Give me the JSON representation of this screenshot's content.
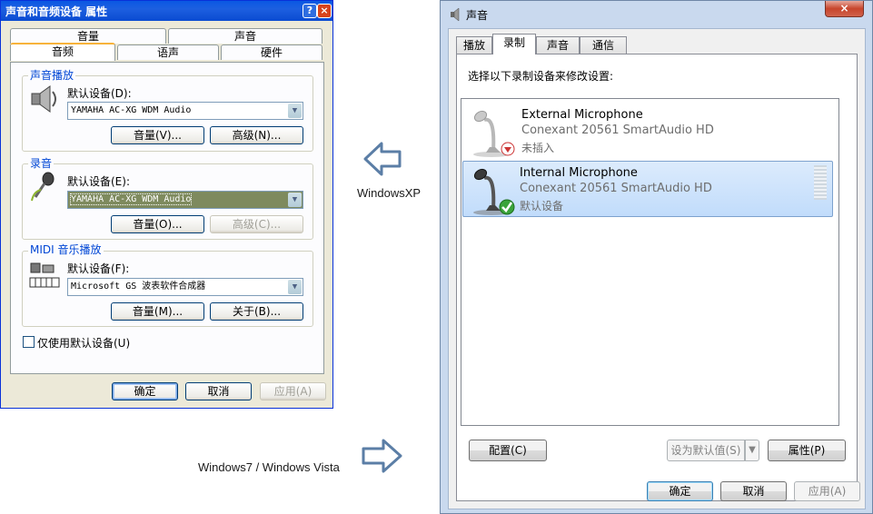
{
  "xp_dialog": {
    "title": "声音和音频设备 属性",
    "help_btn": "?",
    "close_btn": "×",
    "tabs_top": [
      "音量",
      "声音"
    ],
    "tabs_bottom": [
      "音频",
      "语声",
      "硬件"
    ],
    "sound_playback": {
      "group": "声音播放",
      "default_device_label": "默认设备(D):",
      "device": "YAMAHA AC-XG WDM Audio",
      "volume_btn": "音量(V)...",
      "advanced_btn": "高级(N)..."
    },
    "recording": {
      "group": "录音",
      "default_device_label": "默认设备(E):",
      "device": "YAMAHA AC-XG WDM Audio",
      "volume_btn": "音量(O)...",
      "advanced_btn": "高级(C)..."
    },
    "midi": {
      "group": "MIDI 音乐播放",
      "default_device_label": "默认设备(F):",
      "device": "Microsoft GS 波表软件合成器",
      "volume_btn": "音量(M)...",
      "about_btn": "关于(B)..."
    },
    "only_default_checkbox": "仅使用默认设备(U)",
    "ok_btn": "确定",
    "cancel_btn": "取消",
    "apply_btn": "应用(A)"
  },
  "arrows": {
    "xp_caption": "WindowsXP",
    "w7_caption": "Windows7 / Windows Vista"
  },
  "w7_dialog": {
    "title": "声音",
    "close_btn": "×",
    "tabs": [
      "播放",
      "录制",
      "声音",
      "通信"
    ],
    "instruction": "选择以下录制设备来修改设置:",
    "devices": [
      {
        "name": "External Microphone",
        "driver": "Conexant 20561 SmartAudio HD",
        "status": "未插入"
      },
      {
        "name": "Internal Microphone",
        "driver": "Conexant 20561 SmartAudio HD",
        "status": "默认设备"
      }
    ],
    "configure_btn": "配置(C)",
    "set_default_btn": "设为默认值(S)",
    "dropdown_arrow": "▼",
    "properties_btn": "属性(P)",
    "ok_btn": "确定",
    "cancel_btn": "取消",
    "apply_btn": "应用(A)"
  },
  "colors": {
    "xp_title_blue": "#0a58e3",
    "xp_face": "#ece9d8",
    "w7_frame": "#c9d9ee",
    "selection_blue": "#c1dcfb",
    "arrow_outline": "#5b7ea6"
  }
}
